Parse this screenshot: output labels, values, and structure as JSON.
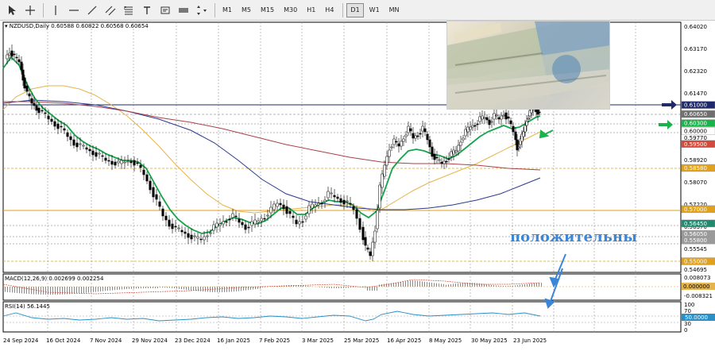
{
  "toolbar": {
    "timeframes": [
      "M1",
      "M5",
      "M15",
      "M30",
      "H1",
      "H4",
      "D1",
      "W1",
      "MN"
    ],
    "active_timeframe": "D1"
  },
  "chart": {
    "symbol_line": "NZDUSD,Daily  0.60588 0.60822 0.60568 0.60654",
    "macd_line": "MACD(12,26,9) 0.002699 0.002254",
    "rsi_line": "RSI(14) 56.1445",
    "annotation": "положительны",
    "price_axis": [
      "0.64020",
      "0.63170",
      "0.62320",
      "0.61470",
      "0.59770",
      "0.58920",
      "0.58070",
      "0.57220",
      "0.56370",
      "0.55545",
      "0.54695"
    ],
    "price_badges": [
      {
        "label": "0.61000",
        "color": "#1f2a6b",
        "price": 0.61
      },
      {
        "label": "0.60650",
        "color": "#6f6f6f",
        "price": 0.6065
      },
      {
        "label": "0.60300",
        "color": "#19b34a",
        "price": 0.603
      },
      {
        "label": "0.60000",
        "color": "#ffffff",
        "price": 0.6
      },
      {
        "label": "0.59500",
        "color": "#d24a3b",
        "price": 0.595
      },
      {
        "label": "0.58580",
        "color": "#e0a11e",
        "price": 0.5858
      },
      {
        "label": "0.57000",
        "color": "#e0a11e",
        "price": 0.57
      },
      {
        "label": "0.56450",
        "color": "#1f8a70",
        "price": 0.5645
      },
      {
        "label": "0.56050",
        "color": "#9a9a9a",
        "price": 0.5605
      },
      {
        "label": "0.55800",
        "color": "#9a9a9a",
        "price": 0.558
      },
      {
        "label": "0.55000",
        "color": "#e0a11e",
        "price": 0.55
      }
    ],
    "macd_axis": [
      "0.008073",
      "0.000000",
      "-0.008321"
    ],
    "rsi_axis": [
      "100",
      "70",
      "50.0000",
      "30",
      "0"
    ],
    "date_axis": [
      "24 Sep 2024",
      "16 Oct 2024",
      "7 Nov 2024",
      "29 Nov 2024",
      "23 Dec 2024",
      "16 Jan 2025",
      "7 Feb 2025",
      "3 Mar 2025",
      "25 Mar 2025",
      "16 Apr 2025",
      "8 May 2025",
      "30 May 2025",
      "23 Jun 2025"
    ],
    "colors": {
      "ma_fast": "#16a34a",
      "ma_slow": "#e6b44c",
      "ma_blue": "#2a3a8f",
      "ma_red": "#a8424a",
      "level_dark": "#1f2a6b",
      "level_gray": "#6f6f6f",
      "level_orange": "#e0a11e",
      "annotation": "#3a86d8"
    }
  }
}
